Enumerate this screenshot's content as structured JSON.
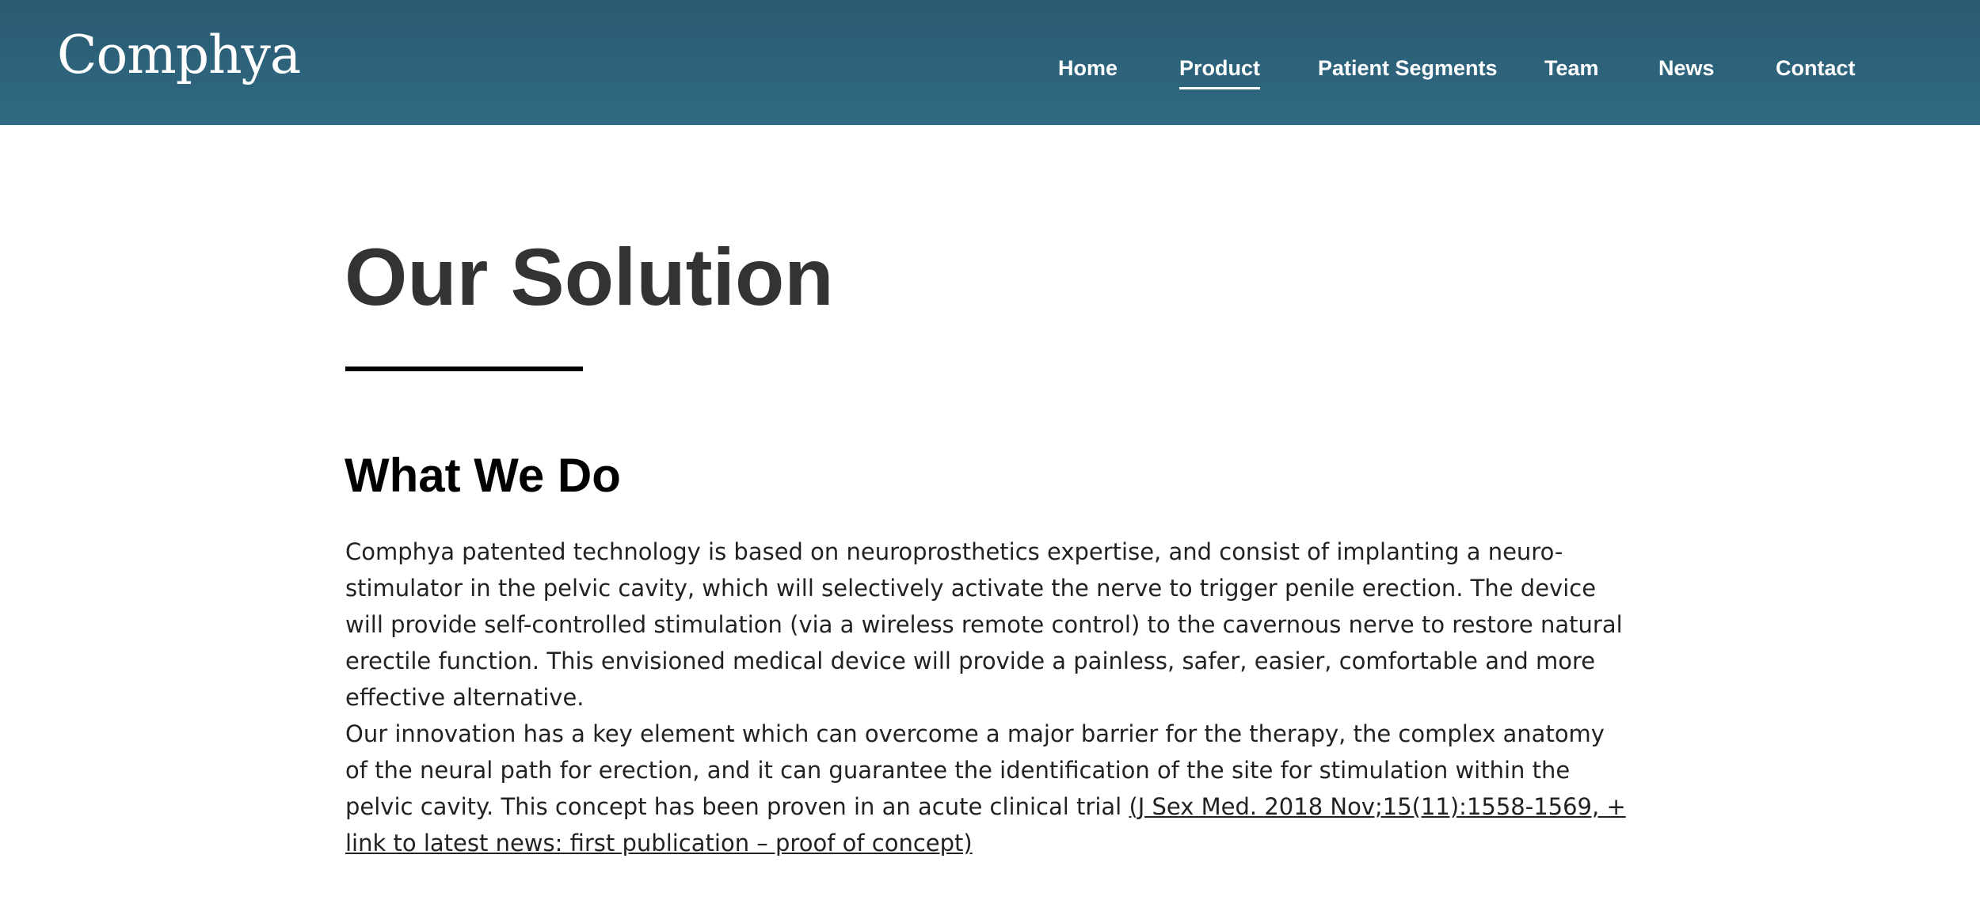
{
  "header": {
    "logo": "Comphya",
    "nav": [
      "Home",
      "Product",
      "Patient Segments",
      "Team",
      "News",
      "Contact"
    ],
    "active_nav": "Product",
    "background_color": "#2c6279"
  },
  "main": {
    "title": "Our Solution",
    "subtitle": "What We Do",
    "paragraph1": "Comphya patented technology is based on neuroprosthetics expertise, and consist of implanting a neuro-stimulator in the pelvic cavity, which will selectively activate the nerve to trigger penile erection. The device will provide self-controlled stimulation (via a wireless remote control) to the cavernous nerve to restore natural erectile function. This envisioned medical device will provide a painless, safer, easier, comfortable and more effective alternative.",
    "paragraph2_text": "Our innovation has a key element which can overcome a major barrier for the therapy, the complex anatomy of the neural path for erection, and it can guarantee the identification of the site for stimulation within the pelvic cavity. This concept has been proven in an acute clinical trial ",
    "paragraph2_link": "(J Sex Med. 2018 Nov;15(11):1558-1569, + link to latest news: first publication – proof of concept)"
  }
}
